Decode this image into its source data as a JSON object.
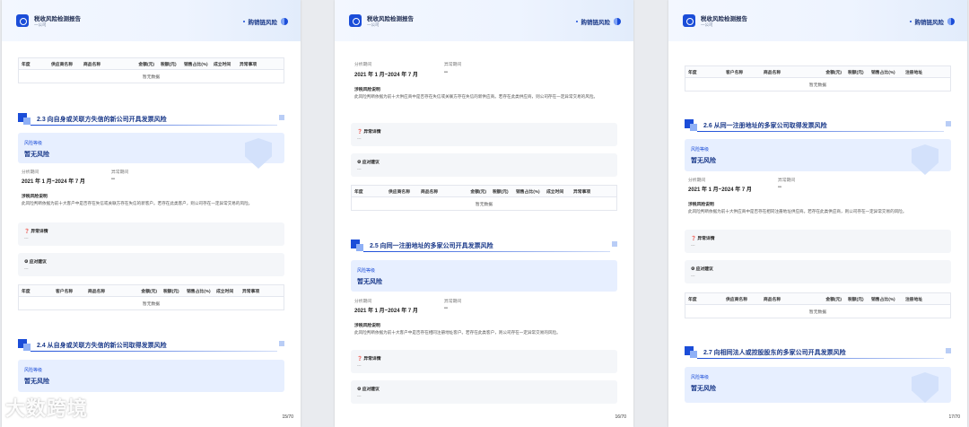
{
  "header": {
    "title": "税收风险检测报告",
    "subtitle": "一公司",
    "section": "购销链风险"
  },
  "cols_supplier": [
    "年度",
    "供应商名称",
    "商品名称",
    "金额(元)",
    "税额(元)",
    "销售占比(%)",
    "成立时间",
    "异常事项"
  ],
  "cols_customer": [
    "年度",
    "客户名称",
    "商品名称",
    "金额(元)",
    "税额(元)",
    "销售占比(%)",
    "成立时间",
    "异常事项"
  ],
  "cols_addr_customer": [
    "年度",
    "客户名称",
    "商品名称",
    "金额(元)",
    "税额(元)",
    "销售占比(%)",
    "注册地址"
  ],
  "cols_addr_supplier": [
    "年度",
    "供应商名称",
    "商品名称",
    "金额(元)",
    "税额(元)",
    "销售占比(%)",
    "注册地址"
  ],
  "no_data": "暂无数据",
  "risk_label": "风险等级",
  "risk_value": "暂无风险",
  "period_label": "分析期间",
  "period_value": "2021 年 1 月~2024 年 7 月",
  "abnormal_label": "异常期间",
  "abnormal_value": "--",
  "desc_label": "涉税风险说明",
  "detail_label": "异常详情",
  "advice_label": "应对建议",
  "empty": "---",
  "sections": {
    "s23": "2.3 向自身或关联方失信的新公司开具发票风险",
    "s24": "2.4 从自身或关联方失信的新公司取得发票风险",
    "s25": "2.5 向同一注册地址的多家公司开具发票风险",
    "s26": "2.6 从同一注册地址的多家公司取得发票风险",
    "s27": "2.7 向相同法人或控股股东的多家公司开具发票风险"
  },
  "desc": {
    "d23": "此风险判断依据为前十大客户中是否存在失信或关联方存在失信的新客户。若存在此类客户，则公司存在一定异常交易的风险。",
    "d25": "此风险判断依据为前十大客户中是否存在相同注册地址客户。若存在此类客户，则公司存在一定异常交易的风险。",
    "d26": "此风险判断依据为前十大供应商中是否存在相同注册地址供应商。若存在此类供应商，则公司存在一定异常交易的风险。",
    "d24": "此风险判断依据为前十大供应商中是否存在失信或关联方存在失信的新供应商。若存在此类供应商，则公司存在一定异常交易的风险。"
  },
  "pages": [
    "15/70",
    "16/70",
    "17/70"
  ],
  "watermark": "大数跨境"
}
